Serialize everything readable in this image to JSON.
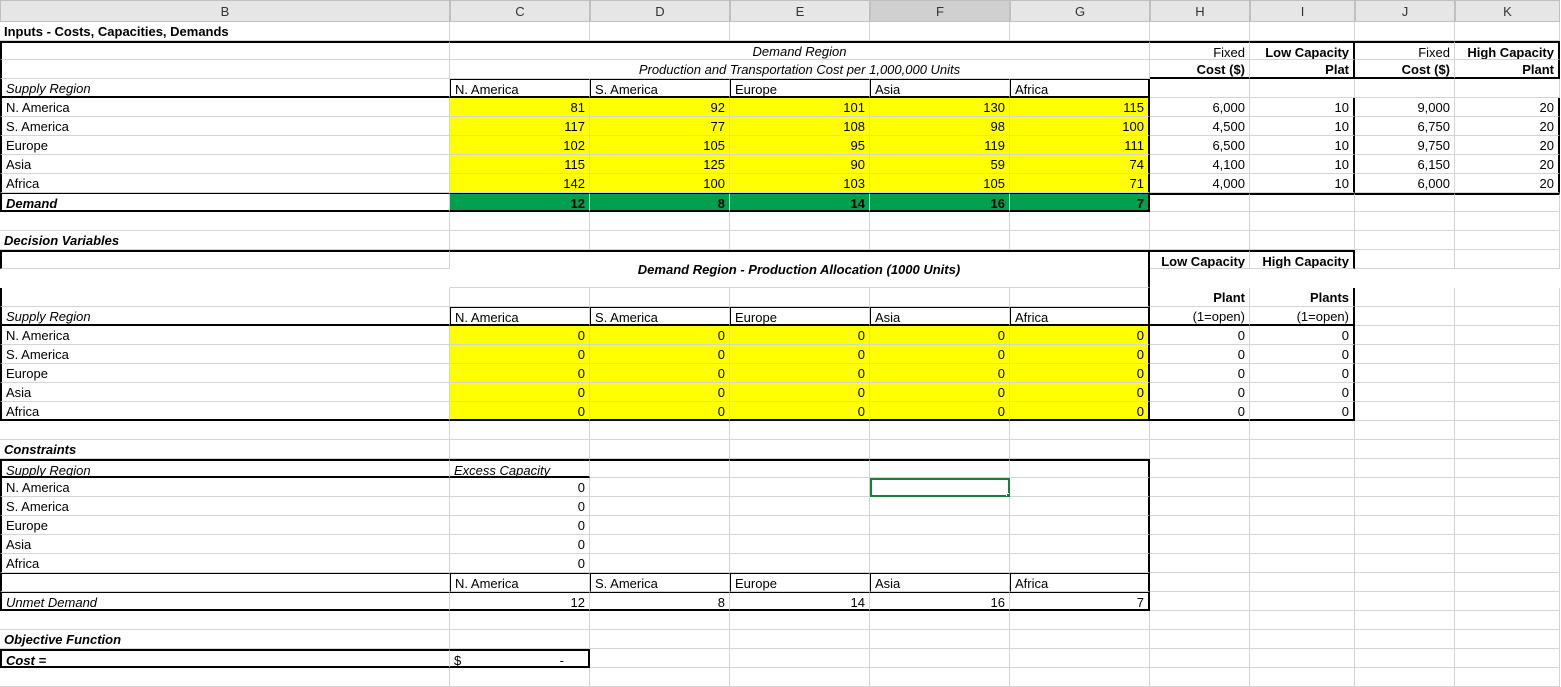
{
  "columns": [
    "B",
    "C",
    "D",
    "E",
    "F",
    "G",
    "H",
    "I",
    "J",
    "K"
  ],
  "selectedCol": "F",
  "sec1": {
    "title": "Inputs - Costs, Capacities, Demands",
    "demandRegion": "Demand Region",
    "subtitle": "Production and Transportation Cost per 1,000,000 Units",
    "fixed": "Fixed",
    "cost": "Cost ($)",
    "lowCap": "Low Capacity",
    "plat": "Plat",
    "highCap": "High Capacity",
    "plant": "Plant",
    "supplyRegion": "Supply Region",
    "demandLabel": "Demand",
    "regions": [
      "N. America",
      "S. America",
      "Europe",
      "Asia",
      "Africa"
    ],
    "costs": [
      [
        81,
        92,
        101,
        130,
        115
      ],
      [
        117,
        77,
        108,
        98,
        100
      ],
      [
        102,
        105,
        95,
        119,
        111
      ],
      [
        115,
        125,
        90,
        59,
        74
      ],
      [
        142,
        100,
        103,
        105,
        71
      ]
    ],
    "fixedLow": [
      "6,000",
      "4,500",
      "6,500",
      "4,100",
      "4,000"
    ],
    "capLow": [
      10,
      10,
      10,
      10,
      10
    ],
    "fixedHigh": [
      "9,000",
      "6,750",
      "9,750",
      "6,150",
      "6,000"
    ],
    "capHigh": [
      20,
      20,
      20,
      20,
      20
    ],
    "demand": [
      12,
      8,
      14,
      16,
      7
    ]
  },
  "sec2": {
    "title": "Decision Variables",
    "header": "Demand Region - Production Allocation (1000 Units)",
    "supplyRegion": "Supply Region",
    "lowCap": "Low Capacity",
    "plant": "Plant",
    "highCap": "High Capacity",
    "plants": "Plants",
    "open": "(1=open)",
    "regions": [
      "N. America",
      "S. America",
      "Europe",
      "Asia",
      "Africa"
    ],
    "alloc": [
      [
        0,
        0,
        0,
        0,
        0
      ],
      [
        0,
        0,
        0,
        0,
        0
      ],
      [
        0,
        0,
        0,
        0,
        0
      ],
      [
        0,
        0,
        0,
        0,
        0
      ],
      [
        0,
        0,
        0,
        0,
        0
      ]
    ],
    "low": [
      0,
      0,
      0,
      0,
      0
    ],
    "high": [
      0,
      0,
      0,
      0,
      0
    ]
  },
  "sec3": {
    "title": "Constraints",
    "supplyRegion": "Supply Region",
    "excess": "Excess Capacity",
    "regions": [
      "N. America",
      "S. America",
      "Europe",
      "Asia",
      "Africa"
    ],
    "excessVals": [
      0,
      0,
      0,
      0,
      0
    ],
    "unmetLabel": "Unmet Demand",
    "unmet": [
      12,
      8,
      14,
      16,
      7
    ]
  },
  "sec4": {
    "title": "Objective Function",
    "costLabel": "Cost =",
    "costSymbol": "$",
    "costDash": "-"
  }
}
